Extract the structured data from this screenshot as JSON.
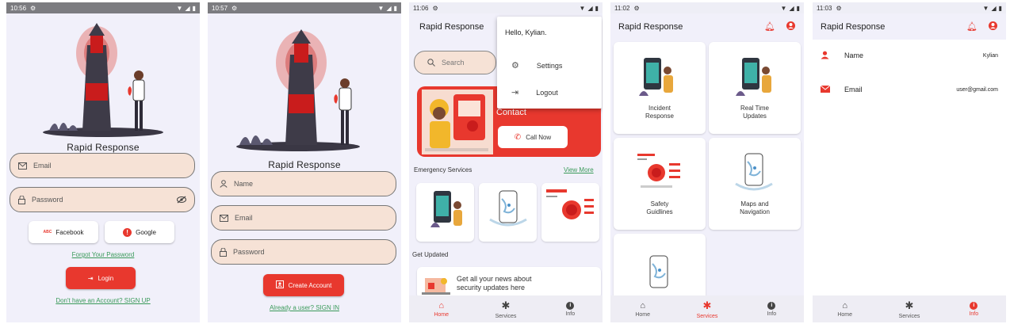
{
  "screens": {
    "login": {
      "status_time": "10:56",
      "brand": "Rapid Response",
      "email_placeholder": "Email",
      "password_placeholder": "Password",
      "facebook_label": "Facebook",
      "google_label": "Google",
      "forgot_link": "Forgot Your Password",
      "login_label": "Login",
      "signup_link": "Don't have an Account? SIGN UP"
    },
    "signup": {
      "status_time": "10:57",
      "brand": "Rapid Response",
      "name_placeholder": "Name",
      "email_placeholder": "Email",
      "password_placeholder": "Password",
      "create_label": "Create Account",
      "signin_link": "Already a user? SIGN IN"
    },
    "home": {
      "status_time": "11:06",
      "title": "Rapid Response",
      "search_placeholder": "Search",
      "menu": {
        "greeting": "Hello, Kylian.",
        "settings": "Settings",
        "logout": "Logout"
      },
      "banner": {
        "heading": "Contact",
        "call_label": "Call Now"
      },
      "emergency_label": "Emergency Services",
      "view_more": "View More",
      "get_updated": "Get Updated",
      "news_text_line1": "Get all your news about",
      "news_text_line2": "security updates here"
    },
    "services": {
      "status_time": "11:02",
      "title": "Rapid Response",
      "tiles": [
        {
          "label": "Incident\nResponse"
        },
        {
          "label": "Real Time\nUpdates"
        },
        {
          "label": "Safety\nGuidlines"
        },
        {
          "label": "Maps and\nNavigation"
        },
        {
          "label": ""
        }
      ]
    },
    "profile": {
      "status_time": "11:03",
      "title": "Rapid Response",
      "name_label": "Name",
      "name_value": "Kylian",
      "email_label": "Email",
      "email_value": "user@gmail.com"
    }
  },
  "navbar": {
    "home": "Home",
    "services": "Services",
    "info": "Info"
  },
  "colors": {
    "accent": "#e8382e",
    "field_bg": "#f6e2d6",
    "screen_bg": "#f1f0fa",
    "link": "#3a9a5a"
  }
}
